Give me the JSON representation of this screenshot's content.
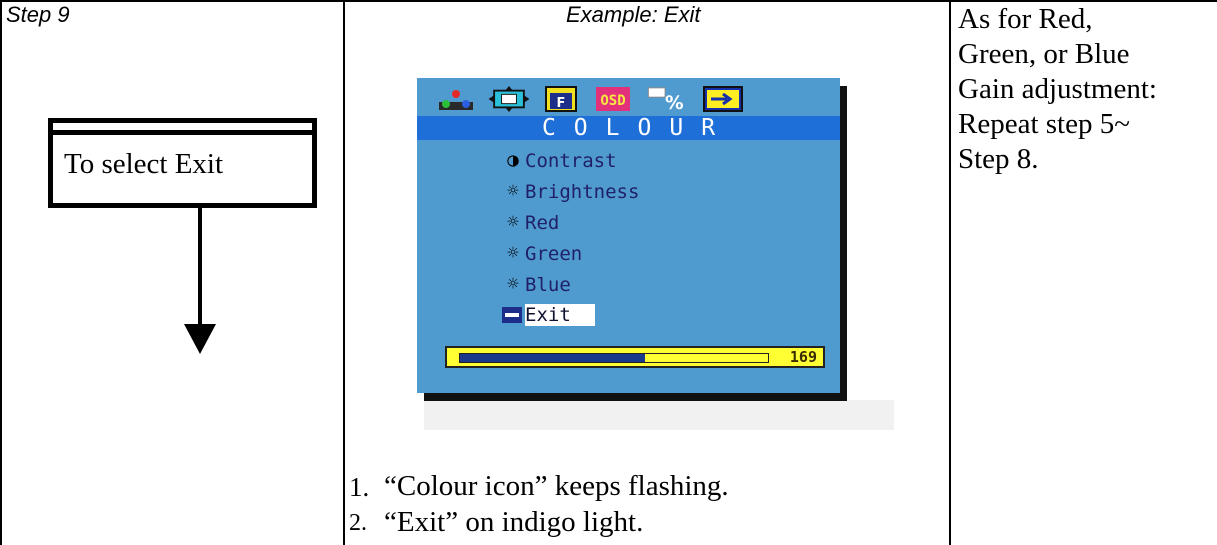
{
  "table": {
    "step_label": "Step 9",
    "example_label": "Example: Exit"
  },
  "callout": {
    "text": "To select Exit"
  },
  "osd": {
    "title": "COLOUR",
    "menu_items": [
      {
        "label": "Contrast",
        "icon": "contrast-icon"
      },
      {
        "label": "Brightness",
        "icon": "sun-icon"
      },
      {
        "label": "Red",
        "icon": "sun-icon"
      },
      {
        "label": "Green",
        "icon": "sun-icon"
      },
      {
        "label": "Blue",
        "icon": "sun-icon"
      },
      {
        "label": "Exit",
        "icon": "return-icon",
        "selected": true
      }
    ],
    "slider_value": "169",
    "slider_fraction": 0.6,
    "colors": {
      "panel": "#4f9bd0",
      "titlebar": "#1f6fd8",
      "bar": "#ffff33",
      "fill": "#1c3a8c"
    }
  },
  "notes": [
    {
      "num": "1.",
      "text": "“Colour icon” keeps flashing."
    },
    {
      "num": "2.",
      "text": "“Exit” on indigo light."
    }
  ],
  "right_column": {
    "lines": [
      "As for Red,",
      "Green, or Blue",
      "Gain adjustment:",
      "Repeat step 5~",
      "Step 8."
    ]
  }
}
